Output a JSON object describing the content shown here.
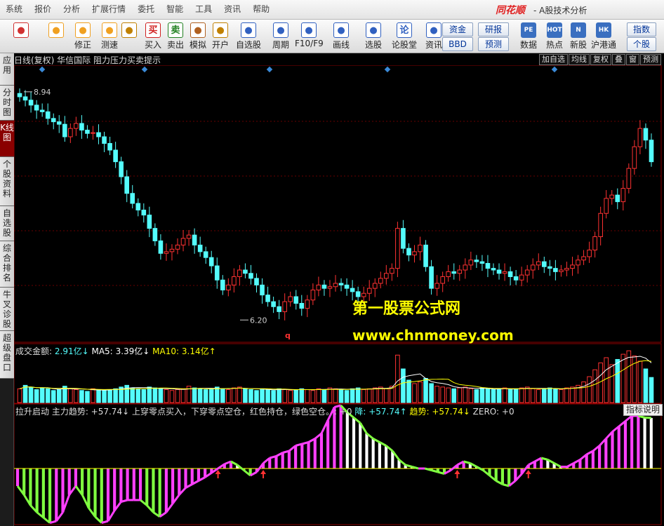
{
  "menu": [
    "系统",
    "报价",
    "分析",
    "扩展行情",
    "委托",
    "智能",
    "工具",
    "资讯",
    "帮助"
  ],
  "brand": "同花顺",
  "window_title": "- A股技术分析",
  "toolbar": [
    {
      "label": "",
      "icon": "windows-icon",
      "color": "#d03030"
    },
    {
      "label": "",
      "icon": "back-arrow-icon",
      "color": "#f0a020"
    },
    {
      "label": "修正",
      "icon": "updown-arrow-icon",
      "color": "#f0a020"
    },
    {
      "label": "测速",
      "icon": "speed-icon",
      "color": "#f0a020"
    },
    {
      "label": "",
      "icon": "clock-icon",
      "color": "#c08000"
    },
    {
      "label": "买入",
      "icon": "buy-icon",
      "glyph": "买",
      "color": "#d02020"
    },
    {
      "label": "卖出",
      "icon": "sell-icon",
      "glyph": "卖",
      "color": "#208020"
    },
    {
      "label": "模拟",
      "icon": "hammer-icon",
      "color": "#b06020"
    },
    {
      "label": "开户",
      "icon": "lock-icon",
      "color": "#c08000"
    },
    {
      "label": "自选股",
      "icon": "star-icon",
      "color": "#3060c0"
    },
    {
      "label": "周期",
      "icon": "cycle-icon",
      "color": "#3060c0"
    },
    {
      "label": "F10/F9",
      "icon": "f10-icon",
      "color": "#3060c0"
    },
    {
      "label": "画线",
      "icon": "pen-icon",
      "color": "#3060c0"
    },
    {
      "label": "选股",
      "icon": "select-icon",
      "color": "#3060c0"
    },
    {
      "label": "论股堂",
      "icon": "forum-icon",
      "glyph": "论",
      "color": "#3060c0"
    },
    {
      "label": "资讯",
      "icon": "news-icon",
      "color": "#3060c0"
    }
  ],
  "toolbar_boxes": [
    "资金",
    "BBD",
    "研报",
    "预测",
    "指数",
    "个股"
  ],
  "toolbar_right": [
    {
      "label": "数据",
      "icon": "pe-icon",
      "glyph": "PE"
    },
    {
      "label": "热点",
      "icon": "hot-icon",
      "glyph": "HOT"
    },
    {
      "label": "新股",
      "icon": "new-icon",
      "glyph": "N"
    },
    {
      "label": "沪港通",
      "icon": "hk-icon",
      "glyph": "HK"
    }
  ],
  "side_tabs": [
    "应用",
    "分时图",
    "K线图",
    "个股资料",
    "自选股",
    "综合排名",
    "牛叉诊股",
    "超级盘口"
  ],
  "chart_info": "日线(复权) 华信国际 阻力压力买卖提示",
  "right_buttons": [
    "加自选",
    "均线",
    "复权",
    "叠",
    "窗",
    "预测"
  ],
  "vol": {
    "title": "成交金额:",
    "value": "2.91亿↓",
    "ma5_label": "MA5:",
    "ma5": "3.39亿↓",
    "ma10_label": "MA10:",
    "ma10": "3.14亿↑"
  },
  "indicator": {
    "title": "拉升启动 主力趋势: +57.74↓ 上穿零点买入，下穿零点空仓，红色持仓，绿色空仓。: +0",
    "down_label": "降:",
    "down_val": "+57.74↑",
    "trend_label": "趋势: +57.74↓",
    "zero_label": "ZERO: +0",
    "help": "指标说明"
  },
  "annotations": {
    "high": "8.94",
    "low": "6.20",
    "q": "q"
  },
  "watermark": {
    "line1": "第一股票公式网",
    "line2": "www.chnmoney.com"
  },
  "colors": {
    "up": "#ff3232",
    "down": "#54fcfc",
    "ma_white": "#ffffff",
    "ma_yellow": "#ffff00",
    "pink": "#ff40ff",
    "green": "#80ff40"
  },
  "chart_data": [
    {
      "type": "candlestick",
      "title": "日线(复权) 华信国际 阻力压力买卖提示",
      "ylim": [
        6.0,
        9.2
      ],
      "annotations": [
        {
          "label": "8.94",
          "value": 8.94
        },
        {
          "label": "6.20",
          "value": 6.2
        }
      ],
      "close": [
        8.88,
        8.84,
        8.78,
        8.72,
        8.7,
        8.62,
        8.58,
        8.55,
        8.4,
        8.5,
        8.56,
        8.48,
        8.44,
        8.45,
        8.4,
        8.32,
        8.24,
        8.1,
        7.92,
        7.72,
        7.6,
        7.52,
        7.46,
        7.3,
        7.15,
        7.0,
        7.02,
        7.05,
        7.1,
        7.18,
        7.22,
        7.1,
        7.02,
        6.95,
        6.85,
        6.68,
        6.56,
        6.62,
        6.72,
        6.8,
        6.76,
        6.7,
        6.62,
        6.5,
        6.42,
        6.36,
        6.3,
        6.42,
        6.48,
        6.4,
        6.34,
        6.44,
        6.56,
        6.62,
        6.58,
        6.6,
        6.64,
        6.62,
        6.58,
        6.54,
        6.48,
        6.52,
        6.58,
        6.64,
        6.7,
        6.76,
        6.82,
        7.3,
        7.06,
        6.98,
        7.02,
        7.1,
        6.84,
        6.58,
        6.64,
        6.72,
        6.78,
        6.76,
        6.8,
        6.86,
        6.92,
        6.9,
        6.88,
        6.82,
        6.8,
        6.76,
        6.78,
        6.72,
        6.68,
        6.74,
        6.8,
        6.86,
        6.9,
        6.84,
        6.82,
        6.78,
        6.8,
        6.82,
        6.86,
        6.92,
        6.96,
        7.04,
        7.2,
        7.48,
        7.66,
        7.7,
        7.62,
        7.78,
        8.02,
        8.28,
        8.5,
        8.36,
        8.1
      ]
    },
    {
      "type": "bar",
      "title": "成交金额",
      "series": [
        {
          "name": "成交金额",
          "values": [
            1.6,
            2.0,
            1.8,
            1.5,
            1.7,
            1.6,
            1.4,
            1.5,
            1.9,
            1.6,
            1.5,
            1.4,
            1.3,
            1.6,
            1.5,
            1.4,
            1.5,
            1.6,
            1.8,
            2.0,
            1.7,
            1.6,
            1.5,
            1.8,
            1.7,
            1.6,
            1.5,
            1.4,
            1.5,
            1.6,
            1.9,
            1.7,
            1.6,
            1.5,
            1.6,
            1.8,
            1.6,
            1.5,
            1.7,
            1.8,
            1.6,
            1.5,
            1.4,
            1.6,
            1.5,
            1.4,
            1.6,
            1.5,
            1.4,
            1.5,
            1.6,
            1.5,
            1.4,
            1.6,
            1.5,
            1.7,
            1.6,
            1.5,
            1.4,
            1.6,
            1.7,
            1.5,
            1.6,
            1.7,
            1.8,
            1.6,
            1.9,
            5.5,
            3.9,
            2.6,
            2.2,
            2.4,
            2.8,
            2.2,
            1.9,
            1.8,
            1.7,
            1.6,
            1.7,
            1.8,
            1.6,
            1.5,
            1.7,
            1.6,
            1.5,
            1.6,
            1.7,
            1.5,
            1.6,
            1.7,
            1.8,
            1.6,
            1.5,
            1.6,
            1.7,
            1.6,
            1.5,
            1.7,
            1.8,
            2.0,
            2.4,
            3.0,
            3.8,
            4.6,
            5.2,
            4.4,
            5.0,
            5.6,
            6.0,
            5.4,
            4.8,
            3.9,
            2.91
          ]
        }
      ]
    },
    {
      "type": "line",
      "title": "拉升启动",
      "series": [
        {
          "name": "主力趋势",
          "values": [
            -20,
            -30,
            -42,
            -50,
            -56,
            -62,
            -60,
            -50,
            -30,
            -20,
            -30,
            -45,
            -55,
            -62,
            -60,
            -48,
            -38,
            -36,
            -36,
            -36,
            -42,
            -50,
            -55,
            -50,
            -40,
            -30,
            -22,
            -18,
            -14,
            -10,
            -5,
            0,
            5,
            8,
            4,
            -2,
            -8,
            -4,
            6,
            12,
            14,
            18,
            20,
            26,
            28,
            30,
            34,
            40,
            55,
            70,
            72,
            64,
            58,
            52,
            40,
            34,
            30,
            26,
            20,
            10,
            4,
            2,
            0,
            0,
            -2,
            -4,
            -6,
            -2,
            4,
            8,
            6,
            2,
            -2,
            -8,
            -14,
            -18,
            -20,
            -14,
            -6,
            4,
            8,
            12,
            10,
            6,
            2,
            2,
            6,
            10,
            16,
            20,
            26,
            34,
            42,
            48,
            54,
            60,
            60,
            58,
            57.74
          ]
        }
      ]
    }
  ]
}
